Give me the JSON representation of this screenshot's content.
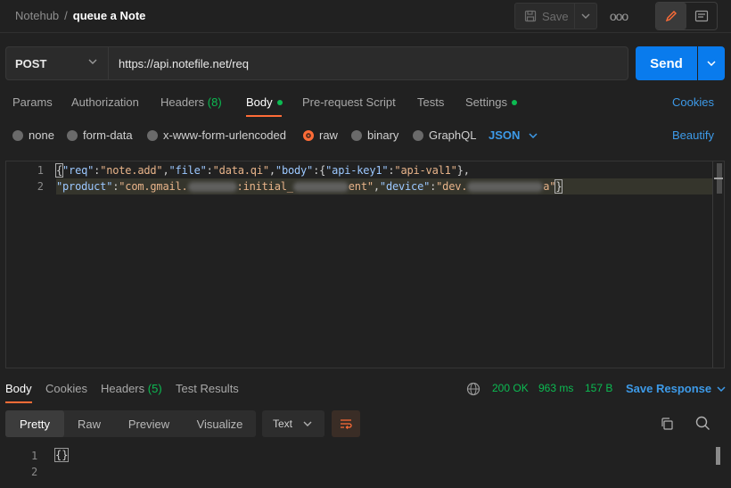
{
  "header": {
    "workspace": "Notehub",
    "separator": "/",
    "request_name": "queue a Note",
    "save_label": "Save",
    "more_label": "ooo"
  },
  "request": {
    "method": "POST",
    "url": "https://api.notefile.net/req",
    "send_label": "Send"
  },
  "request_tabs": [
    {
      "label": "Params"
    },
    {
      "label": "Authorization"
    },
    {
      "label": "Headers",
      "count": "(8)"
    },
    {
      "label": "Body"
    },
    {
      "label": "Pre-request Script"
    },
    {
      "label": "Tests"
    },
    {
      "label": "Settings"
    }
  ],
  "cookies_label": "Cookies",
  "body_types": [
    "none",
    "form-data",
    "x-www-form-urlencoded",
    "raw",
    "binary",
    "GraphQL"
  ],
  "selected_body_type": "raw",
  "format": "JSON",
  "beautify_label": "Beautify",
  "editor": {
    "line_numbers": [
      "1",
      "2"
    ],
    "line1": {
      "k1": "\"req\"",
      "v1": "\"note.add\"",
      "k2": "\"file\"",
      "v2": "\"data.qi\"",
      "k3": "\"body\"",
      "k4": "\"api-key1\"",
      "v4": "\"api-val1\""
    },
    "line2": {
      "k1": "\"product\"",
      "v1a": "\"com.gmail.",
      "v1b": ":initial_",
      "v1c": "ent\"",
      "k2": "\"device\"",
      "v2a": "\"dev.",
      "v2b": "a\""
    }
  },
  "response_tabs": [
    {
      "label": "Body"
    },
    {
      "label": "Cookies"
    },
    {
      "label": "Headers",
      "count": "(5)"
    },
    {
      "label": "Test Results"
    }
  ],
  "response_status": {
    "status": "200 OK",
    "time": "963 ms",
    "size": "157 B",
    "save_response_label": "Save Response"
  },
  "response_views": [
    "Pretty",
    "Raw",
    "Preview",
    "Visualize"
  ],
  "response_format": "Text",
  "response_body": {
    "line_numbers": [
      "1",
      "2"
    ],
    "line1": "{}"
  },
  "colors": {
    "accent": "#ff6c37",
    "primary": "#097bed",
    "link": "#3d9ae8",
    "success": "#0cbb52"
  }
}
